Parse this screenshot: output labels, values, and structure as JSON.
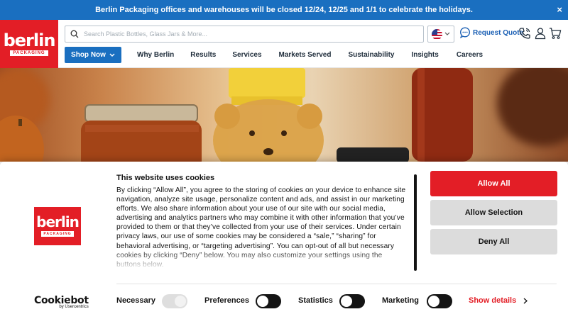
{
  "announcement": {
    "text": "Berlin Packaging offices and warehouses will be closed 12/24, 12/25 and 1/1 to celebrate the holidays.",
    "close": "×"
  },
  "brand": {
    "logo_word": "berlin",
    "logo_sub": "PACKAGING",
    "color": "#e31e26"
  },
  "header": {
    "search_placeholder": "Search Plastic Bottles, Glass Jars & More...",
    "request_quote": "Request Quote",
    "shop_now": "Shop Now",
    "nav": [
      "Why Berlin",
      "Results",
      "Services",
      "Markets Served",
      "Sustainability",
      "Insights",
      "Careers"
    ]
  },
  "cookie_banner": {
    "title": "This website uses cookies",
    "body": "By clicking “Allow All”, you agree to the storing of cookies on your device to enhance site navigation, analyze site usage, personalize content and ads, and assist in our marketing efforts. We also share information about your use of our site with our social media, advertising and analytics partners who may combine it with other information that you’ve provided to them or that they’ve collected from your use of their services. Under certain privacy laws, our use of some cookies may be considered a “sale,” “sharing” for behavioral advertising, or “targeting advertising”. You can opt-out of all but necessary cookies by clicking “Deny” below. You may also customize your settings using the buttons below.",
    "buttons": {
      "allow_all": "Allow All",
      "allow_selection": "Allow Selection",
      "deny_all": "Deny All"
    },
    "toggles": {
      "necessary": {
        "label": "Necessary",
        "state": "on-disabled"
      },
      "preferences": {
        "label": "Preferences",
        "state": "off"
      },
      "statistics": {
        "label": "Statistics",
        "state": "off"
      },
      "marketing": {
        "label": "Marketing",
        "state": "off"
      }
    },
    "show_details": "Show details",
    "cookiebot": {
      "main": "Cookiebot",
      "sub": "by Usercentrics"
    }
  },
  "colors": {
    "accent_blue": "#1a6fc0",
    "accent_red": "#e31e26",
    "dark": "#141414"
  }
}
